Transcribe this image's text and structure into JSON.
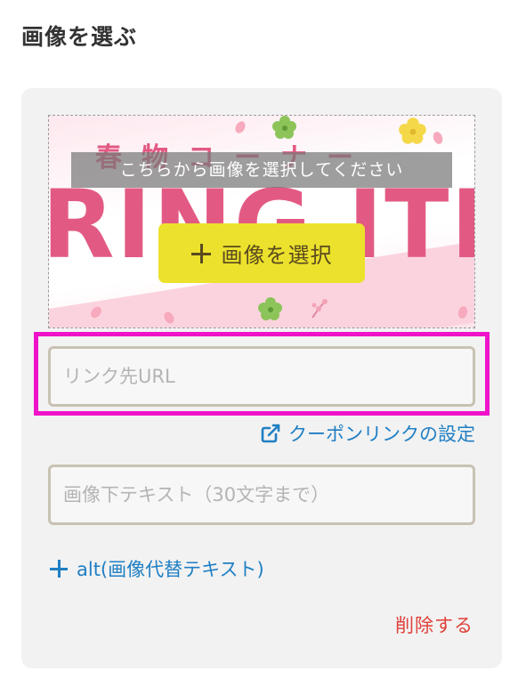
{
  "page": {
    "title": "画像を選ぶ"
  },
  "image_picker": {
    "banner_heading": "春物コーナー",
    "banner_big_text": "RING ITE",
    "instruction": "こちらから画像を選択してください",
    "select_button_label": "画像を選択"
  },
  "link_url": {
    "placeholder": "リンク先URL",
    "value": ""
  },
  "coupon_link": {
    "label": "クーポンリンクの設定",
    "icon": "external-link-icon"
  },
  "caption": {
    "placeholder": "画像下テキスト（30文字まで）",
    "value": ""
  },
  "alt_toggle": {
    "label": "alt(画像代替テキスト)",
    "icon": "plus-icon"
  },
  "delete": {
    "label": "削除する"
  },
  "colors": {
    "accent_blue": "#1f7fc4",
    "select_button": "#ece12c",
    "delete_red": "#e0403a",
    "highlight_magenta": "#ee13c9",
    "banner_pink": "#e25a83"
  }
}
